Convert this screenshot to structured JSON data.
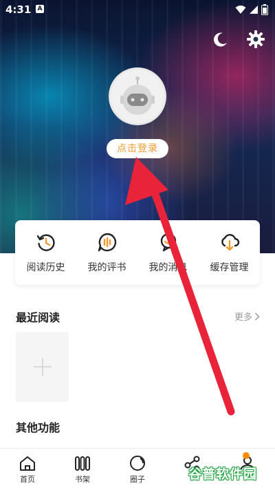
{
  "status_bar": {
    "time": "4:31",
    "badge": "A"
  },
  "header": {
    "night_mode_icon": "moon-icon",
    "settings_icon": "gear-icon"
  },
  "profile": {
    "login_label": "点击登录"
  },
  "quick_actions": [
    {
      "label": "阅读历史",
      "icon": "history-icon"
    },
    {
      "label": "我的评书",
      "icon": "review-icon"
    },
    {
      "label": "我的消息",
      "icon": "message-icon"
    },
    {
      "label": "缓存管理",
      "icon": "cache-icon"
    }
  ],
  "recent": {
    "title": "最近阅读",
    "more_label": "更多"
  },
  "other": {
    "title": "其他功能"
  },
  "bottom_nav": [
    {
      "label": "首页",
      "icon": "home-icon"
    },
    {
      "label": "书架",
      "icon": "bookshelf-icon"
    },
    {
      "label": "圈子",
      "icon": "circle-icon"
    },
    {
      "label": "",
      "icon": "share-icon"
    },
    {
      "label": "",
      "icon": "profile-icon"
    }
  ],
  "watermark": {
    "text": "谷普软件园"
  },
  "colors": {
    "accent": "#f29a2e",
    "annotation_arrow": "#e8233a",
    "badge": "#ff8a00"
  }
}
